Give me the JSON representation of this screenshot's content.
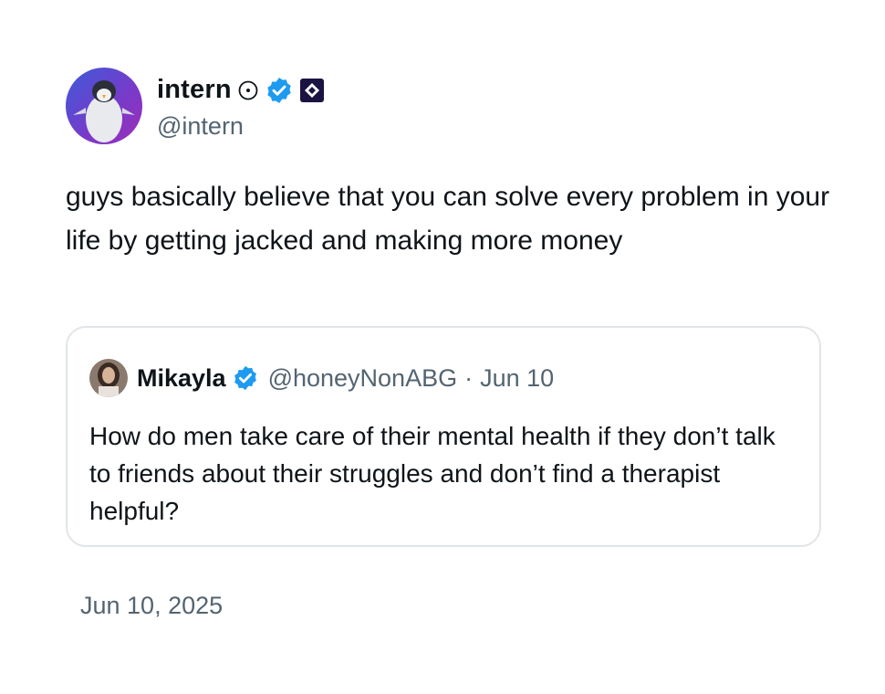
{
  "tweet": {
    "author": {
      "display_name": "intern",
      "handle": "@intern",
      "icons": [
        "clock-icon",
        "verified-badge-icon",
        "affiliate-badge-icon"
      ]
    },
    "text": "guys basically believe that you can solve every problem in your life by getting jacked and making more money",
    "timestamp": "Jun 10, 2025"
  },
  "quote": {
    "author": {
      "display_name": "Mikayla",
      "handle": "@honeyNonABG",
      "separator": "·",
      "date": "Jun 10",
      "icons": [
        "verified-badge-icon"
      ]
    },
    "text": "How do men take care of their mental health if they don’t talk to friends about their struggles and don’t find a therapist helpful?"
  },
  "colors": {
    "verified_blue": "#1d9bf0",
    "secondary_text": "#536471",
    "border": "#e1e5e8",
    "avatar_purple": "#7b39c9"
  }
}
